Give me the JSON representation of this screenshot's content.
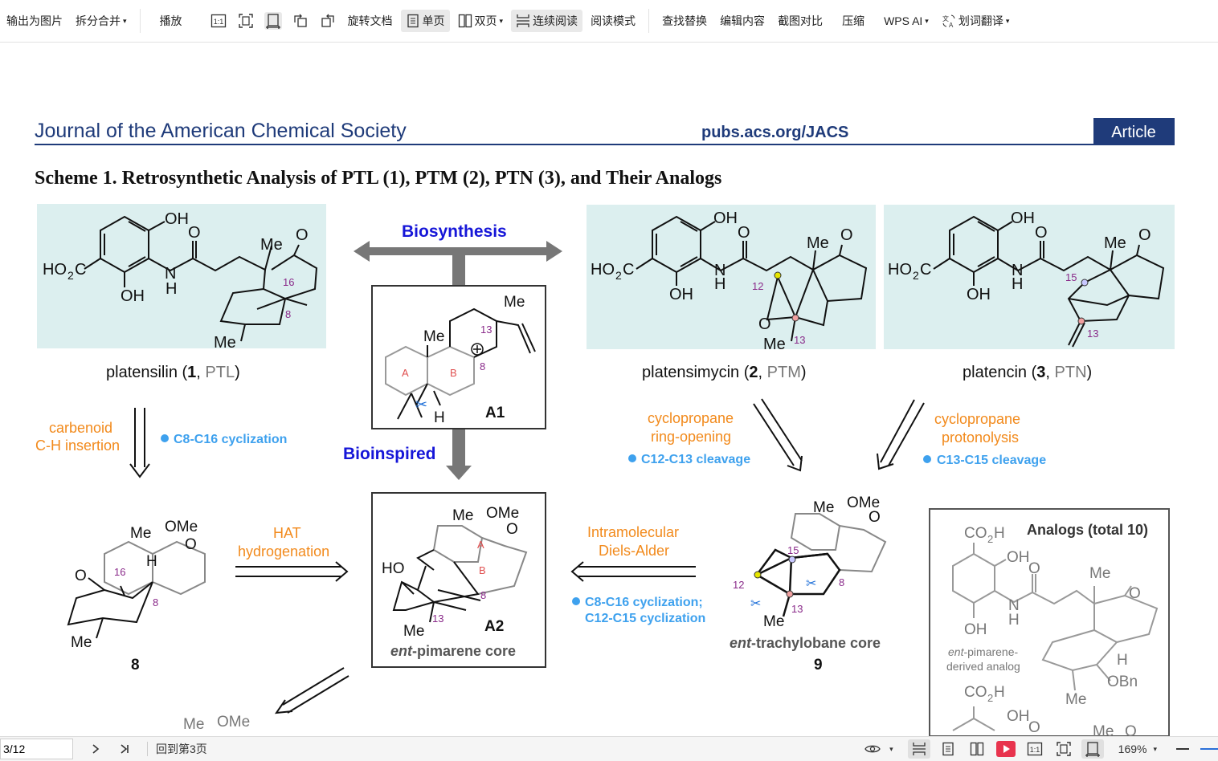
{
  "toolbar": {
    "export_image": "输出为图片",
    "split_merge": "拆分合并",
    "play": "播放",
    "rotate_doc": "旋转文档",
    "single_page": "单页",
    "double_page": "双页",
    "continuous_read": "连续阅读",
    "read_mode": "阅读模式",
    "find_replace": "查找替换",
    "edit_content": "编辑内容",
    "screenshot_compare": "截图对比",
    "compress": "压缩",
    "wps_ai": "WPS AI",
    "translate": "划词翻译"
  },
  "document": {
    "journal": "Journal of the American Chemical Society",
    "url": "pubs.acs.org/JACS",
    "badge": "Article",
    "scheme_title": "Scheme 1. Retrosynthetic Analysis of PTL (1), PTM (2), PTN (3), and Their Analogs",
    "biosynthesis": "Biosynthesis",
    "bioinspired": "Bioinspired",
    "cmp1_name": "platensilin (",
    "cmp1_num": "1",
    "cmp1_abbr": "PTL",
    "cmp2_name": "platensimycin (",
    "cmp2_num": "2",
    "cmp2_abbr": "PTM",
    "cmp3_name": "platencin (",
    "cmp3_num": "3",
    "cmp3_abbr": "PTN",
    "carbenoid": "carbenoid",
    "ch_insertion": "C-H insertion",
    "c8c16_cyc": "C8-C16 cyclization",
    "cyclo_ring_open_1": "cyclopropane",
    "cyclo_ring_open_2": "ring-opening",
    "c12c13": "C12-C13 cleavage",
    "cyclo_proton_1": "cyclopropane",
    "cyclo_proton_2": "protonolysis",
    "c13c15": "C13-C15 cleavage",
    "hat_1": "HAT",
    "hat_2": "hydrogenation",
    "intramol_1": "Intramolecular",
    "intramol_2": "Diels-Alder",
    "c8c16_c12c15_1": "C8-C16 cyclization;",
    "c8c16_c12c15_2": "C12-C15 cyclization",
    "a1_label": "A1",
    "a2_label": "A2",
    "a2_caption_it": "ent",
    "a2_caption": "-pimarene core",
    "cmp8": "8",
    "cmp9": "9",
    "cmp9_caption_it": "ent",
    "cmp9_caption": "-trachylobane core",
    "analogs_title": "Analogs (total 10)",
    "analog_note_it": "ent",
    "analog_note_1": "-pimarene-",
    "analog_note_2": "derived analog"
  },
  "statusbar": {
    "page_input": "3/12",
    "goto": "回到第3页",
    "zoom": "169%"
  },
  "colors": {
    "journal_blue": "#1f3b7a",
    "orange": "#f28a1c",
    "light_blue": "#3ea1ee",
    "dark_blue": "#1616d8",
    "teal_bg": "#dcefef",
    "purple": "#8a2b8a",
    "gray_arrow": "#777777"
  }
}
